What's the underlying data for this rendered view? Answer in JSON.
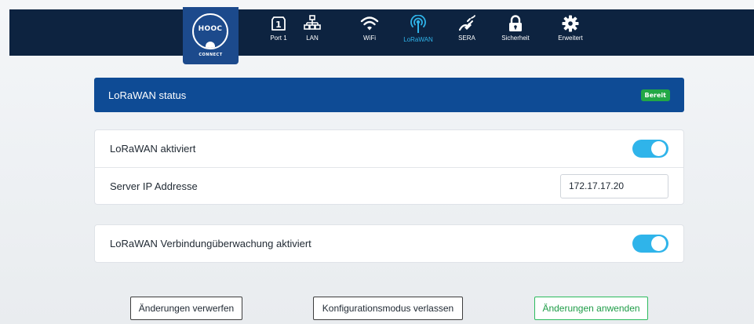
{
  "logo": {
    "text": "HOOC",
    "subtext": "CONNECT"
  },
  "nav": [
    {
      "key": "port1",
      "label": "Port 1",
      "icon": "port-1-icon",
      "badge": "1",
      "active": false
    },
    {
      "key": "lan",
      "label": "LAN",
      "icon": "lan-network-icon",
      "active": false
    },
    {
      "key": "wifi",
      "label": "WiFi",
      "icon": "wifi-icon",
      "active": false
    },
    {
      "key": "lorawan",
      "label": "LoRaWAN",
      "icon": "antenna-icon",
      "active": true
    },
    {
      "key": "sera",
      "label": "SERA",
      "icon": "plug-icon",
      "active": false
    },
    {
      "key": "security",
      "label": "Sicherheit",
      "icon": "lock-icon",
      "active": false
    },
    {
      "key": "advanced",
      "label": "Erweitert",
      "icon": "gear-icon",
      "active": false
    }
  ],
  "status": {
    "title": "LoRaWAN status",
    "badge": "Bereit",
    "badge_color": "#22a745"
  },
  "settings": {
    "lorawan_enabled": {
      "label": "LoRaWAN aktiviert",
      "on": true
    },
    "server_ip": {
      "label": "Server IP Addresse",
      "value": "172.17.17.20"
    },
    "monitoring_enabled": {
      "label": "LoRaWAN Verbindungüberwachung aktiviert",
      "on": true
    }
  },
  "buttons": {
    "discard": "Änderungen verwerfen",
    "exit_config": "Konfigurationsmodus verlassen",
    "apply": "Änderungen anwenden"
  },
  "colors": {
    "topbar": "#0d2340",
    "accent": "#2fb4ea",
    "status_bar": "#0e4b95",
    "apply_border": "#2dbb5e"
  }
}
